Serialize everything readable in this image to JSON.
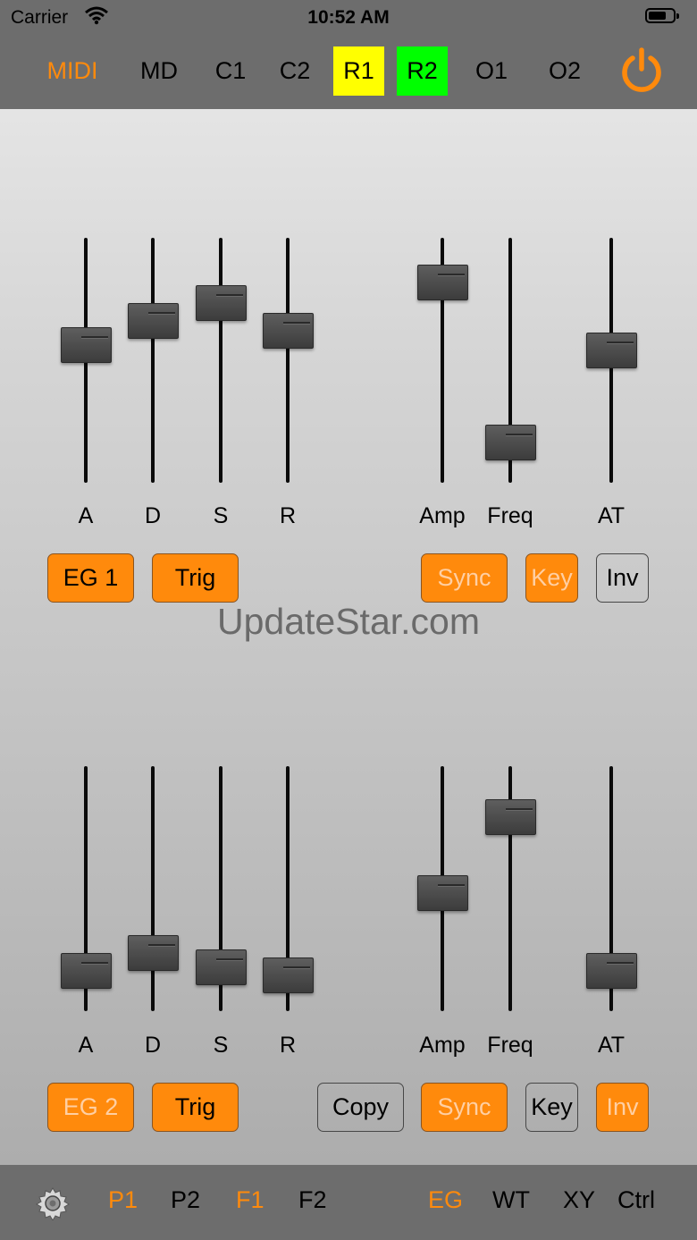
{
  "status_bar": {
    "carrier": "Carrier",
    "time": "10:52 AM"
  },
  "top_tabs": [
    {
      "label": "MIDI",
      "state": "active"
    },
    {
      "label": "MD",
      "state": "normal"
    },
    {
      "label": "C1",
      "state": "normal"
    },
    {
      "label": "C2",
      "state": "normal"
    },
    {
      "label": "R1",
      "state": "yellow"
    },
    {
      "label": "R2",
      "state": "green"
    },
    {
      "label": "O1",
      "state": "normal"
    },
    {
      "label": "O2",
      "state": "normal"
    }
  ],
  "colors": {
    "accent": "#ff8a0c",
    "yellow": "#ffff00",
    "green": "#00ff00",
    "bar": "#6d6d6d"
  },
  "icons": {
    "power": "power-icon",
    "settings": "gear-icon",
    "wifi": "wifi-icon",
    "battery": "battery-icon"
  },
  "eg1": {
    "sliders": [
      {
        "label": "A",
        "value": 0.6
      },
      {
        "label": "D",
        "value": 0.72
      },
      {
        "label": "S",
        "value": 0.81
      },
      {
        "label": "R",
        "value": 0.67
      },
      {
        "label": "Amp",
        "value": 0.91
      },
      {
        "label": "Freq",
        "value": 0.11
      },
      {
        "label": "AT",
        "value": 0.57
      }
    ],
    "buttons": {
      "eg": "EG 1",
      "trig": "Trig",
      "sync": "Sync",
      "key": "Key",
      "inv": "Inv"
    }
  },
  "watermark": "UpdateStar.com",
  "eg2": {
    "sliders": [
      {
        "label": "A",
        "value": 0.11
      },
      {
        "label": "D",
        "value": 0.2
      },
      {
        "label": "S",
        "value": 0.13
      },
      {
        "label": "R",
        "value": 0.09
      },
      {
        "label": "Amp",
        "value": 0.5
      },
      {
        "label": "Freq",
        "value": 0.88
      },
      {
        "label": "AT",
        "value": 0.11
      }
    ],
    "buttons": {
      "eg": "EG 2",
      "trig": "Trig",
      "copy": "Copy",
      "sync": "Sync",
      "key": "Key",
      "inv": "Inv"
    }
  },
  "bottom_tabs": [
    {
      "label": "P1",
      "active": true
    },
    {
      "label": "P2",
      "active": false
    },
    {
      "label": "F1",
      "active": true
    },
    {
      "label": "F2",
      "active": false
    },
    {
      "label": "EG",
      "active": true
    },
    {
      "label": "WT",
      "active": false
    },
    {
      "label": "XY",
      "active": false
    },
    {
      "label": "Ctrl",
      "active": false
    }
  ]
}
